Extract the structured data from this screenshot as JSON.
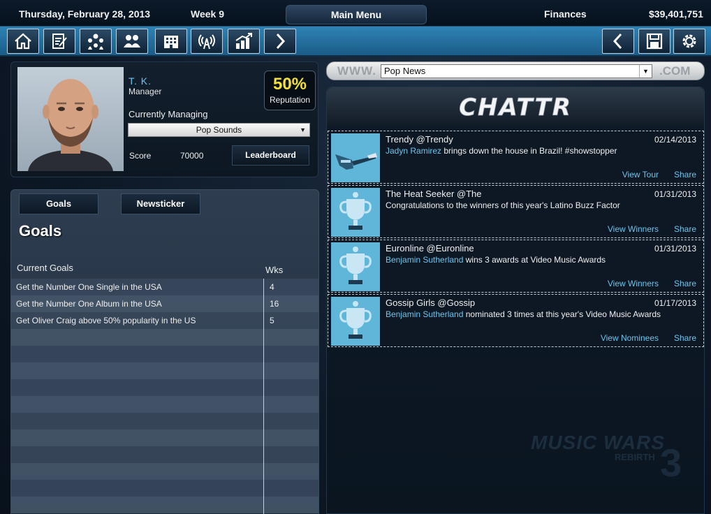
{
  "header": {
    "date": "Thursday, February 28, 2013",
    "week": "Week 9",
    "main_menu": "Main Menu",
    "finances": "Finances",
    "balance": "$39,401,751"
  },
  "toolbar": {
    "buttons": [
      "home-icon",
      "contract-icon",
      "network-icon",
      "people-icon",
      "building-icon",
      "broadcast-icon",
      "chart-icon",
      "chevron-right-icon"
    ],
    "right_buttons": [
      "chevron-left-icon",
      "save-icon",
      "gear-icon"
    ]
  },
  "profile": {
    "name": "T. K.",
    "role": "Manager",
    "reputation_value": "50%",
    "reputation_label": "Reputation",
    "currently_managing_label": "Currently Managing",
    "managing_selected": "Pop Sounds",
    "score_label": "Score",
    "score_value": "70000",
    "leaderboard_button": "Leaderboard",
    "accent_color": "#6fc4ea",
    "reputation_color": "#f4e03a"
  },
  "goals_panel": {
    "tabs": [
      "Goals",
      "Newsticker"
    ],
    "title": "Goals",
    "col_goals": "Current Goals",
    "col_weeks": "Wks",
    "rows": [
      {
        "goal": "Get the Number One Single in the USA",
        "weeks": "4"
      },
      {
        "goal": "Get the Number One Album in the USA",
        "weeks": "16"
      },
      {
        "goal": "Get Oliver Craig above 50% popularity in the US",
        "weeks": "5"
      },
      {
        "goal": "",
        "weeks": ""
      },
      {
        "goal": "",
        "weeks": ""
      },
      {
        "goal": "",
        "weeks": ""
      },
      {
        "goal": "",
        "weeks": ""
      },
      {
        "goal": "",
        "weeks": ""
      },
      {
        "goal": "",
        "weeks": ""
      },
      {
        "goal": "",
        "weeks": ""
      },
      {
        "goal": "",
        "weeks": ""
      },
      {
        "goal": "",
        "weeks": ""
      },
      {
        "goal": "",
        "weeks": ""
      },
      {
        "goal": "",
        "weeks": ""
      }
    ]
  },
  "browser": {
    "www": "WWW.",
    "url_value": "Pop News",
    "com": ".COM",
    "logo": "CHATTR"
  },
  "feed": [
    {
      "author": "Trendy @Trendy",
      "date": "02/14/2013",
      "highlight": "Jadyn Ramirez",
      "text": " brings down the house in Brazil! #showstopper",
      "action": "View Tour",
      "share": "Share",
      "thumb": "guitar-icon"
    },
    {
      "author": "The Heat Seeker @The",
      "date": "01/31/2013",
      "highlight": "",
      "text": "Congratulations to the winners of this year's Latino Buzz Factor",
      "action": "View Winners",
      "share": "Share",
      "thumb": "trophy-icon"
    },
    {
      "author": "Euronline @Euronline",
      "date": "01/31/2013",
      "highlight": "Benjamin Sutherland",
      "text": " wins 3 awards at Video Music Awards",
      "action": "View Winners",
      "share": "Share",
      "thumb": "trophy-icon"
    },
    {
      "author": "Gossip Girls @Gossip",
      "date": "01/17/2013",
      "highlight": "Benjamin Sutherland",
      "text": " nominated 3 times at this year's Video Music Awards",
      "action": "View Nominees",
      "share": "Share",
      "thumb": "trophy-icon"
    }
  ],
  "watermark": {
    "line1": "MUSIC WARS",
    "line2": "REBIRTH",
    "num": "3"
  }
}
